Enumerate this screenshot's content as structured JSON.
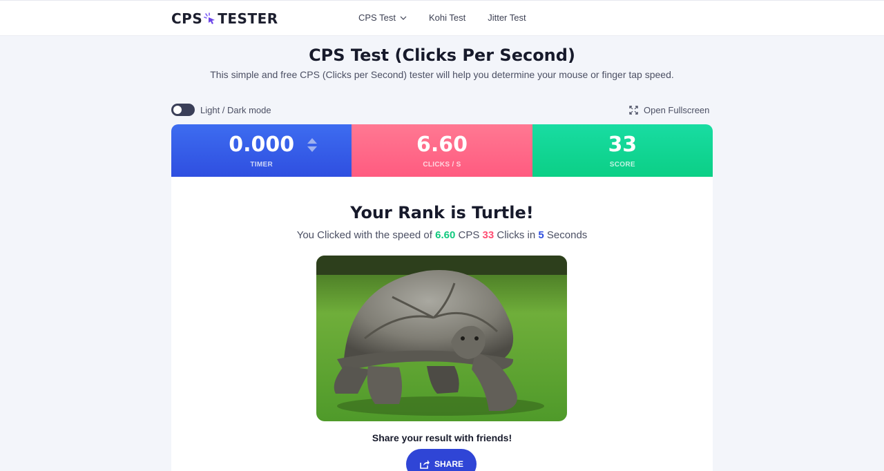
{
  "brand": {
    "left": "CPS",
    "right": "TESTER"
  },
  "nav": {
    "items": [
      "CPS Test",
      "Kohi Test",
      "Jitter Test"
    ]
  },
  "header": {
    "title": "CPS Test (Clicks Per Second)",
    "subtitle": "This simple and free CPS (Clicks per Second) tester will help you determine your mouse or finger tap speed."
  },
  "toolbar": {
    "mode_label": "Light / Dark mode",
    "fullscreen_label": "Open Fullscreen"
  },
  "stats": {
    "timer": {
      "value": "0.000",
      "label": "TIMER"
    },
    "cps": {
      "value": "6.60",
      "label": "CLICKS / S"
    },
    "score": {
      "value": "33",
      "label": "SCORE"
    }
  },
  "result": {
    "rank_title": "Your Rank is Turtle!",
    "prefix": "You Clicked with the speed of",
    "cps": "6.60",
    "cps_unit": "CPS",
    "clicks": "33",
    "clicks_mid": "Clicks in",
    "seconds": "5",
    "seconds_unit": "Seconds"
  },
  "share": {
    "title": "Share your result with friends!",
    "button": "SHARE"
  },
  "colors": {
    "timer": "#2f4fe0",
    "cps": "#ff5b80",
    "score": "#0bcf86",
    "share_button": "#2f45d6"
  },
  "icons": {
    "fullscreen": "expand-icon",
    "share": "share-icon",
    "nav_dropdown": "chevron-down-icon"
  }
}
